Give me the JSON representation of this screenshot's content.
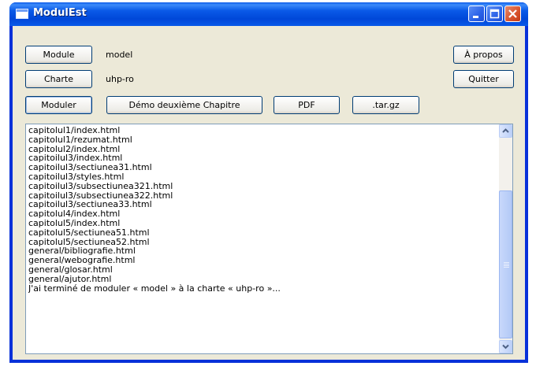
{
  "window": {
    "title": "ModulEst"
  },
  "top_row": {
    "module_button": "Module",
    "module_value": "model",
    "about_button": "À propos"
  },
  "second_row": {
    "charte_button": "Charte",
    "charte_value": "uhp-ro",
    "quit_button": "Quitter"
  },
  "action_row": {
    "moduler_button": "Moduler",
    "demo_button": "Démo deuxième Chapitre",
    "pdf_button": "PDF",
    "targz_button": ".tar.gz"
  },
  "log": {
    "lines": [
      "capitolul1/index.html",
      "capitolul1/rezumat.html",
      "capitolul2/index.html",
      "capitoilul3/index.html",
      "capitoilul3/sectiunea31.html",
      "capitoilul3/styles.html",
      "capitoilul3/subsectiunea321.html",
      "capitoilul3/subsectiunea322.html",
      "capitoilul3/sectiunea33.html",
      "capitolul4/index.html",
      "capitolul5/index.html",
      "capitolul5/sectiunea51.html",
      "capitolul5/sectiunea52.html",
      "general/bibliografie.html",
      "general/webografie.html",
      "general/glosar.html",
      "general/ajutor.html",
      "J'ai terminé de moduler « model » à la charte « uhp-ro »..."
    ]
  },
  "icons": {
    "minimize": "minimize-icon",
    "maximize": "maximize-icon",
    "close": "close-icon",
    "scroll_up": "chevron-up-icon",
    "scroll_down": "chevron-down-icon"
  }
}
